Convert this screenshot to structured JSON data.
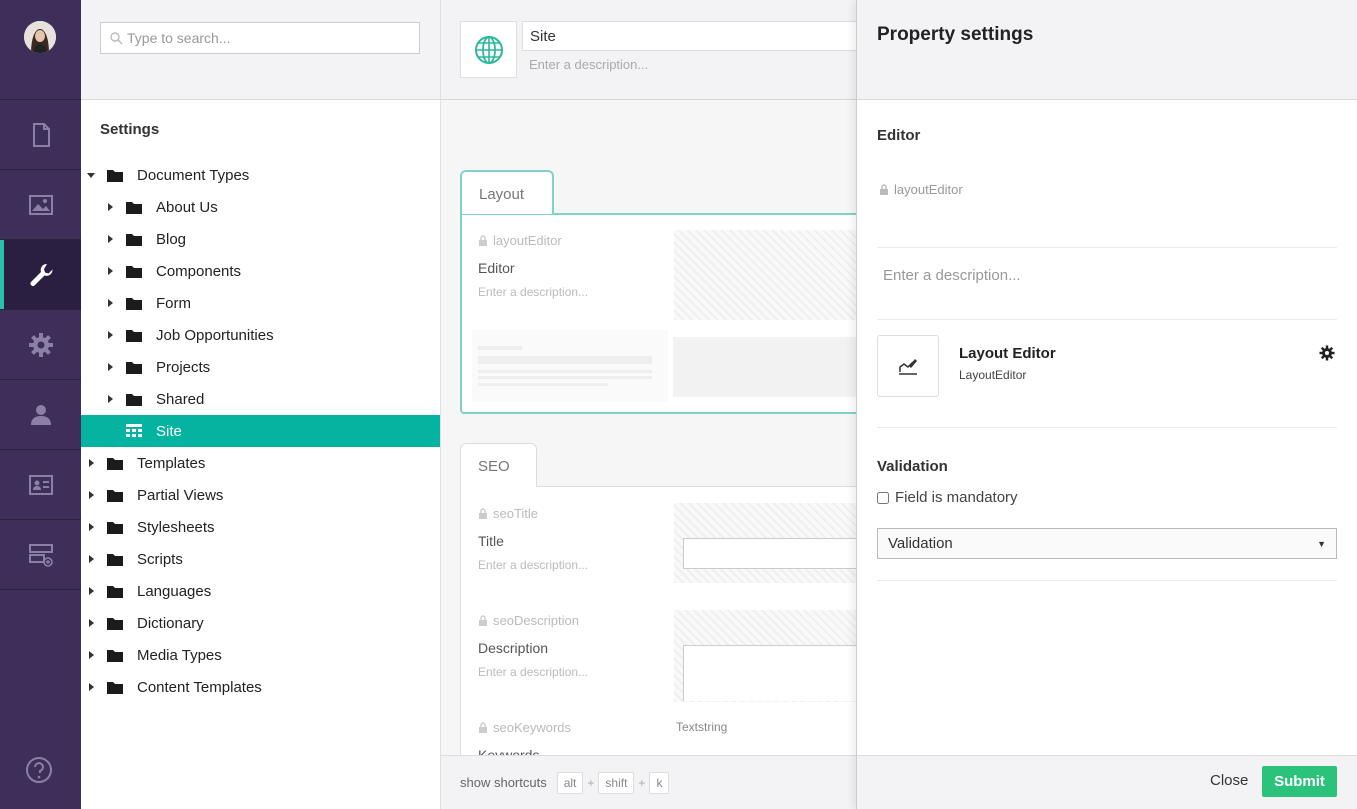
{
  "tree": {
    "search_placeholder": "Type to search...",
    "title": "Settings",
    "nodes": [
      {
        "label": "Document Types",
        "level": 0,
        "expanded": true
      },
      {
        "label": "About Us",
        "level": 1
      },
      {
        "label": "Blog",
        "level": 1
      },
      {
        "label": "Components",
        "level": 1
      },
      {
        "label": "Form",
        "level": 1
      },
      {
        "label": "Job Opportunities",
        "level": 1
      },
      {
        "label": "Projects",
        "level": 1
      },
      {
        "label": "Shared",
        "level": 1
      },
      {
        "label": "Site",
        "level": 1,
        "selected": true
      },
      {
        "label": "Templates",
        "level": 0
      },
      {
        "label": "Partial Views",
        "level": 0
      },
      {
        "label": "Stylesheets",
        "level": 0
      },
      {
        "label": "Scripts",
        "level": 0
      },
      {
        "label": "Languages",
        "level": 0
      },
      {
        "label": "Dictionary",
        "level": 0
      },
      {
        "label": "Media Types",
        "level": 0
      },
      {
        "label": "Content Templates",
        "level": 0
      }
    ]
  },
  "editor": {
    "name": "Site",
    "description_placeholder": "Enter a description...",
    "groups": [
      {
        "tab": "Layout",
        "props": [
          {
            "alias": "layoutEditor",
            "type": "Layout Editor",
            "name": "Editor",
            "description": "Enter a description..."
          }
        ]
      },
      {
        "tab": "SEO",
        "props": [
          {
            "alias": "seoTitle",
            "type": "Textstring",
            "name": "Title",
            "description": "Enter a description..."
          },
          {
            "alias": "seoDescription",
            "type": "Textarea",
            "name": "Description",
            "description": "Enter a description..."
          },
          {
            "alias": "seoKeywords",
            "type": "Textstring",
            "name": "Keywords",
            "description": ""
          }
        ]
      }
    ],
    "footer": {
      "shortcuts_label": "show shortcuts",
      "keys": [
        "alt",
        "shift",
        "k"
      ],
      "plus": "+"
    }
  },
  "panel": {
    "title": "Property settings",
    "editor_label": "Editor",
    "alias": "layoutEditor",
    "description_placeholder": "Enter a description...",
    "editor_name": "Layout Editor",
    "editor_alias": "LayoutEditor",
    "validation_label": "Validation",
    "mandatory_label": "Field is mandatory",
    "validation_select": "Validation",
    "close_label": "Close",
    "submit_label": "Submit"
  },
  "colors": {
    "sidebar_bg": "#3d2f59",
    "accent_teal": "#04b3a0",
    "submit_green": "#2bc37c"
  }
}
